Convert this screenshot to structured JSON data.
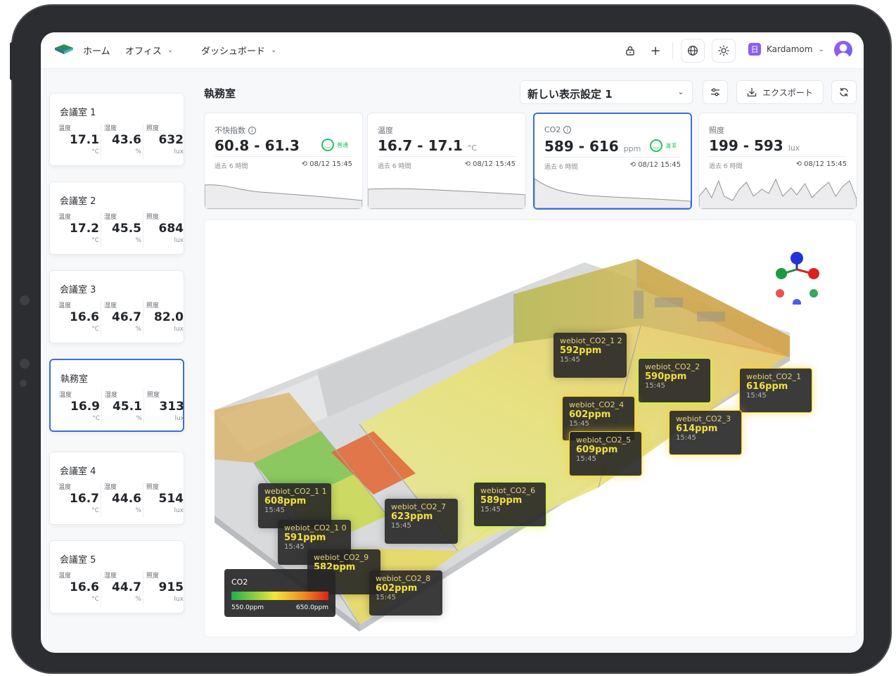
{
  "header": {
    "nav": [
      {
        "label": "ホーム"
      },
      {
        "label": "オフィス"
      },
      {
        "label": "ダッシュボード"
      }
    ],
    "user": {
      "badge": "日",
      "name": "Kardamom"
    }
  },
  "sidebar": {
    "rooms": [
      {
        "name": "会議室 1",
        "temp": "17.1",
        "humidity": "43.6",
        "lux": "632"
      },
      {
        "name": "会議室 2",
        "temp": "17.2",
        "humidity": "45.5",
        "lux": "684"
      },
      {
        "name": "会議室 3",
        "temp": "16.6",
        "humidity": "46.7",
        "lux": "82.0"
      },
      {
        "name": "執務室",
        "temp": "16.9",
        "humidity": "45.1",
        "lux": "313",
        "active": true
      },
      {
        "name": "会議室 4",
        "temp": "16.7",
        "humidity": "44.6",
        "lux": "514"
      },
      {
        "name": "会議室 5",
        "temp": "16.6",
        "humidity": "44.7",
        "lux": "915"
      }
    ],
    "labels": {
      "temp": "温度",
      "humidity": "湿度",
      "lux": "照度"
    },
    "units": {
      "temp": "°C",
      "humidity": "%",
      "lux": "lux"
    }
  },
  "main": {
    "title": "執務室",
    "view_setting": "新しい表示設定 1",
    "export_label": "エクスポート"
  },
  "stats": [
    {
      "label": "不快指数",
      "value": "60.8 - 61.3",
      "unit": "",
      "status": "普通",
      "period": "過去 6 時間",
      "time": "08/12 15:45"
    },
    {
      "label": "温度",
      "value": "16.7 - 17.1",
      "unit": "°C",
      "status": "",
      "period": "過去 6 時間",
      "time": "08/12 15:45"
    },
    {
      "label": "CO2",
      "value": "589 - 616",
      "unit": "ppm",
      "status": "清潔",
      "period": "過去 6 時間",
      "time": "08/12 15:45",
      "active": true
    },
    {
      "label": "照度",
      "value": "199 - 593",
      "unit": "lux",
      "status": "",
      "period": "過去 6 時間",
      "time": "08/12 15:45"
    }
  ],
  "sensors": [
    {
      "name": "webiot_CO2_1 2",
      "value": "592ppm",
      "time": "15:45"
    },
    {
      "name": "webiot_CO2_2",
      "value": "590ppm",
      "time": "15:45"
    },
    {
      "name": "webiot_CO2_1",
      "value": "616ppm",
      "time": "15:45"
    },
    {
      "name": "webiot_CO2_4",
      "value": "602ppm",
      "time": "15:45"
    },
    {
      "name": "webiot_CO2_5",
      "value": "609ppm",
      "time": "15:45"
    },
    {
      "name": "webiot_CO2_3",
      "value": "614ppm",
      "time": "15:45"
    },
    {
      "name": "webiot_CO2_6",
      "value": "589ppm",
      "time": "15:45"
    },
    {
      "name": "webiot_CO2_1 1",
      "value": "608ppm",
      "time": "15:45"
    },
    {
      "name": "webiot_CO2_7",
      "value": "623ppm",
      "time": "15:45"
    },
    {
      "name": "webiot_CO2_1 0",
      "value": "591ppm",
      "time": "15:45"
    },
    {
      "name": "webiot_CO2_9",
      "value": "582ppm",
      "time": ""
    },
    {
      "name": "webiot_CO2_8",
      "value": "602ppm",
      "time": "15:45"
    }
  ],
  "legend": {
    "title": "CO2",
    "min": "550.0ppm",
    "max": "650.0ppm"
  },
  "colors": {
    "accent": "#3b6fd6",
    "good": "#22c55e"
  }
}
